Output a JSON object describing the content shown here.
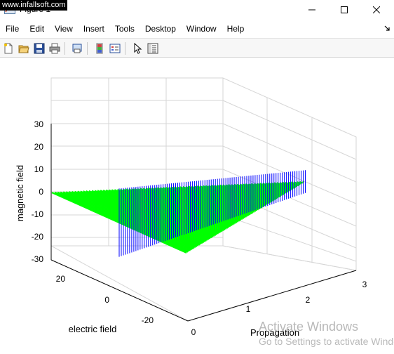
{
  "window": {
    "title": "Figure 1",
    "watermark": "www.infallsoft.com"
  },
  "menu": {
    "items": [
      "File",
      "Edit",
      "View",
      "Insert",
      "Tools",
      "Desktop",
      "Window",
      "Help"
    ]
  },
  "toolbar": {
    "buttons": [
      "new-figure",
      "open-file",
      "save-figure",
      "print-figure",
      "print-preview",
      "toggle-colorbar",
      "insert-legend",
      "edit-plot",
      "property-inspector"
    ]
  },
  "plot": {
    "zlabel": "magnetic field",
    "ylabel": "electric field",
    "xlabel": "Propagation",
    "z_ticks": [
      "30",
      "20",
      "10",
      "0",
      "-10",
      "-20",
      "-30"
    ],
    "y_ticks": [
      "20",
      "0",
      "-20"
    ],
    "x_ticks": [
      "0",
      "1",
      "2",
      "3"
    ],
    "colors": {
      "electric": "#00ff00",
      "magnetic": "#0000ff",
      "edge": "#000000"
    }
  },
  "chart_data": {
    "type": "surface3d",
    "xlabel": "Propagation",
    "ylabel": "electric field",
    "zlabel": "magnetic field",
    "xlim": [
      0,
      3
    ],
    "ylim": [
      -30,
      30
    ],
    "zlim": [
      -30,
      30
    ],
    "series": [
      {
        "name": "",
        "color": "#00ff00",
        "x_range": [
          0,
          3
        ],
        "y_amplitude_range": [
          0,
          30
        ]
      },
      {
        "name": "",
        "color": "#0000ff",
        "x_range": [
          0,
          3
        ],
        "z_amplitude_range": [
          10,
          30
        ]
      }
    ]
  },
  "overlay": {
    "activate_title": "Activate Windows",
    "activate_sub": "Go to Settings to activate Windows."
  }
}
